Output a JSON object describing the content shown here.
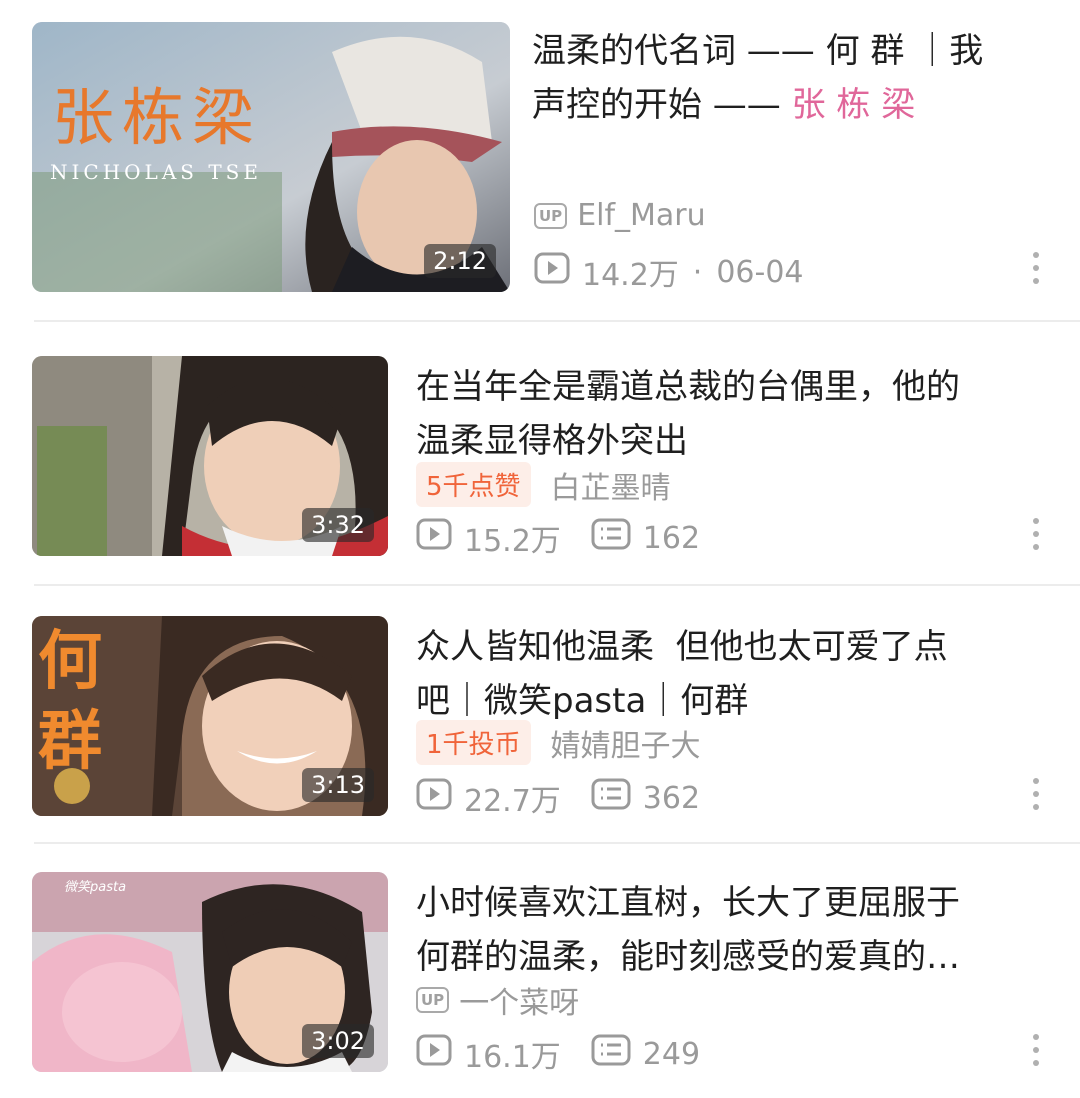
{
  "videos": [
    {
      "duration": "2:12",
      "thumb_overlay": "张栋梁",
      "thumb_overlay_en": "NICHOLAS TSE",
      "title_main": "温柔的代名词 —— 何 群 ｜我声控的开始 —— ",
      "title_highlight": "张 栋 梁",
      "title_line1": "温柔的代名词 —— 何 群 ｜我",
      "title_line2": "声控的开始 —— ",
      "tag": "",
      "uploader_badge": "UP",
      "uploader": "Elf_Maru",
      "views": "14.2万",
      "separator": "·",
      "date": "06-04"
    },
    {
      "duration": "3:32",
      "title_line1": "在当年全是霸道总裁的台偶里，他的",
      "title_line2": "温柔显得格外突出",
      "tag": "5千点赞",
      "uploader": "白芷墨晴",
      "views": "15.2万",
      "comments": "162"
    },
    {
      "duration": "3:13",
      "thumb_overlay": "何群",
      "title_line1": "众人皆知他温柔  但他也太可爱了点",
      "title_line2": "吧｜微笑pasta｜何群",
      "tag": "1千投币",
      "uploader": "婧婧胆子大",
      "views": "22.7万",
      "comments": "362"
    },
    {
      "duration": "3:02",
      "thumb_overlay": "微笑pasta",
      "title_line1": "小时候喜欢江直树，长大了更屈服于",
      "title_line2": "何群的温柔，能时刻感受的爱真的…",
      "uploader_badge": "UP",
      "uploader": "一个菜呀",
      "views": "16.1万",
      "comments": "249"
    }
  ],
  "icons": {
    "play": "play-count-icon",
    "comment": "danmaku-count-icon",
    "more": "more-vertical-icon",
    "up": "uploader-badge-icon"
  },
  "colors": {
    "highlight": "#e0679a",
    "tag_text": "#f0643a",
    "tag_bg": "#fdeee8",
    "meta": "#9a9a9a"
  }
}
